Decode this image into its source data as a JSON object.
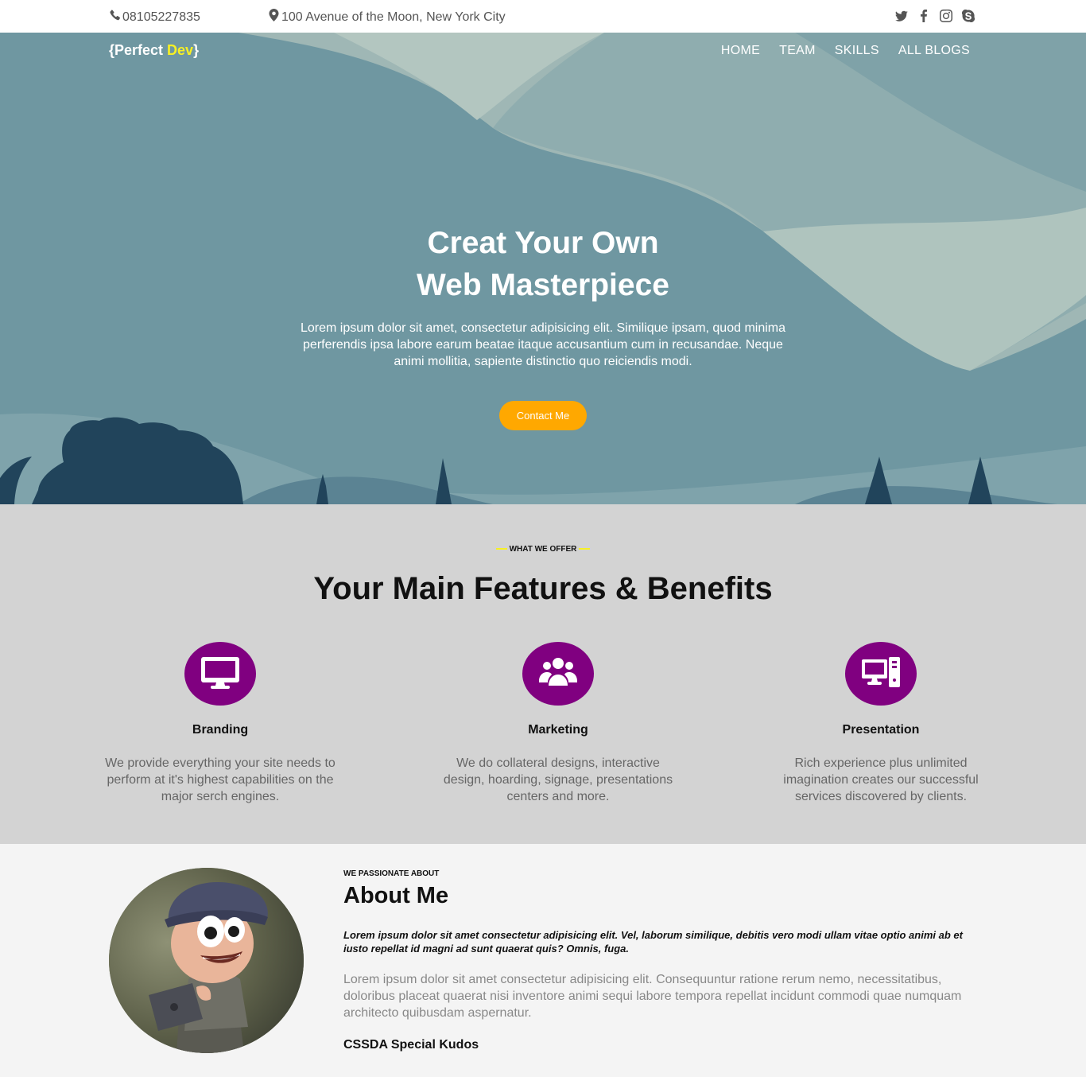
{
  "topbar": {
    "phone": "08105227835",
    "address": "100 Avenue of the Moon, New York City",
    "social": [
      "twitter-icon",
      "facebook-icon",
      "instagram-icon",
      "skype-icon"
    ]
  },
  "header": {
    "logo_open": "{Perfect ",
    "logo_accent": "Dev",
    "logo_close": "}",
    "nav": [
      "HOME",
      "TEAM",
      "SKILLS",
      "ALL BLOGS"
    ]
  },
  "hero": {
    "title_line1": "Creat Your Own",
    "title_line2": "Web Masterpiece",
    "text": "Lorem ipsum dolor sit amet, consectetur adipisicing elit. Similique ipsam, quod minima perferendis ipsa labore earum beatae itaque accusantium cum in recusandae. Neque animi mollitia, sapiente distinctio quo reiciendis modi.",
    "button": "Contact Me"
  },
  "features": {
    "eyebrow": "WHAT WE OFFER",
    "title": "Your Main Features & Benefits",
    "items": [
      {
        "icon": "monitor-icon",
        "title": "Branding",
        "text": "We provide everything your site needs to perform at it's highest capabilities on the major serch engines."
      },
      {
        "icon": "users-icon",
        "title": "Marketing",
        "text": "We do collateral designs, interactive design, hoarding, signage, presentations centers and more."
      },
      {
        "icon": "desktop-icon",
        "title": "Presentation",
        "text": "Rich experience plus unlimited imagination creates our successful services discovered by clients."
      }
    ]
  },
  "about": {
    "eyebrow": "WE PASSIONATE ABOUT",
    "title": "About Me",
    "lead": "Lorem ipsum dolor sit amet consectetur adipisicing elit. Vel, laborum similique, debitis vero modi ullam vitae optio animi ab et iusto repellat id magni ad sunt quaerat quis? Omnis, fuga.",
    "text": "Lorem ipsum dolor sit amet consectetur adipisicing elit. Consequuntur ratione rerum nemo, necessitatibus, doloribus placeat quaerat nisi inventore animi sequi labore tempora repellat incidunt commodi quae numquam architecto quibusdam aspernatur.",
    "kudos": "CSSDA Special Kudos"
  },
  "colors": {
    "accent_yellow": "#f7f024",
    "button_orange": "#ffa800",
    "icon_purple": "#800080",
    "hero_bg": "#6f97a1",
    "features_bg": "#d3d3d3"
  }
}
